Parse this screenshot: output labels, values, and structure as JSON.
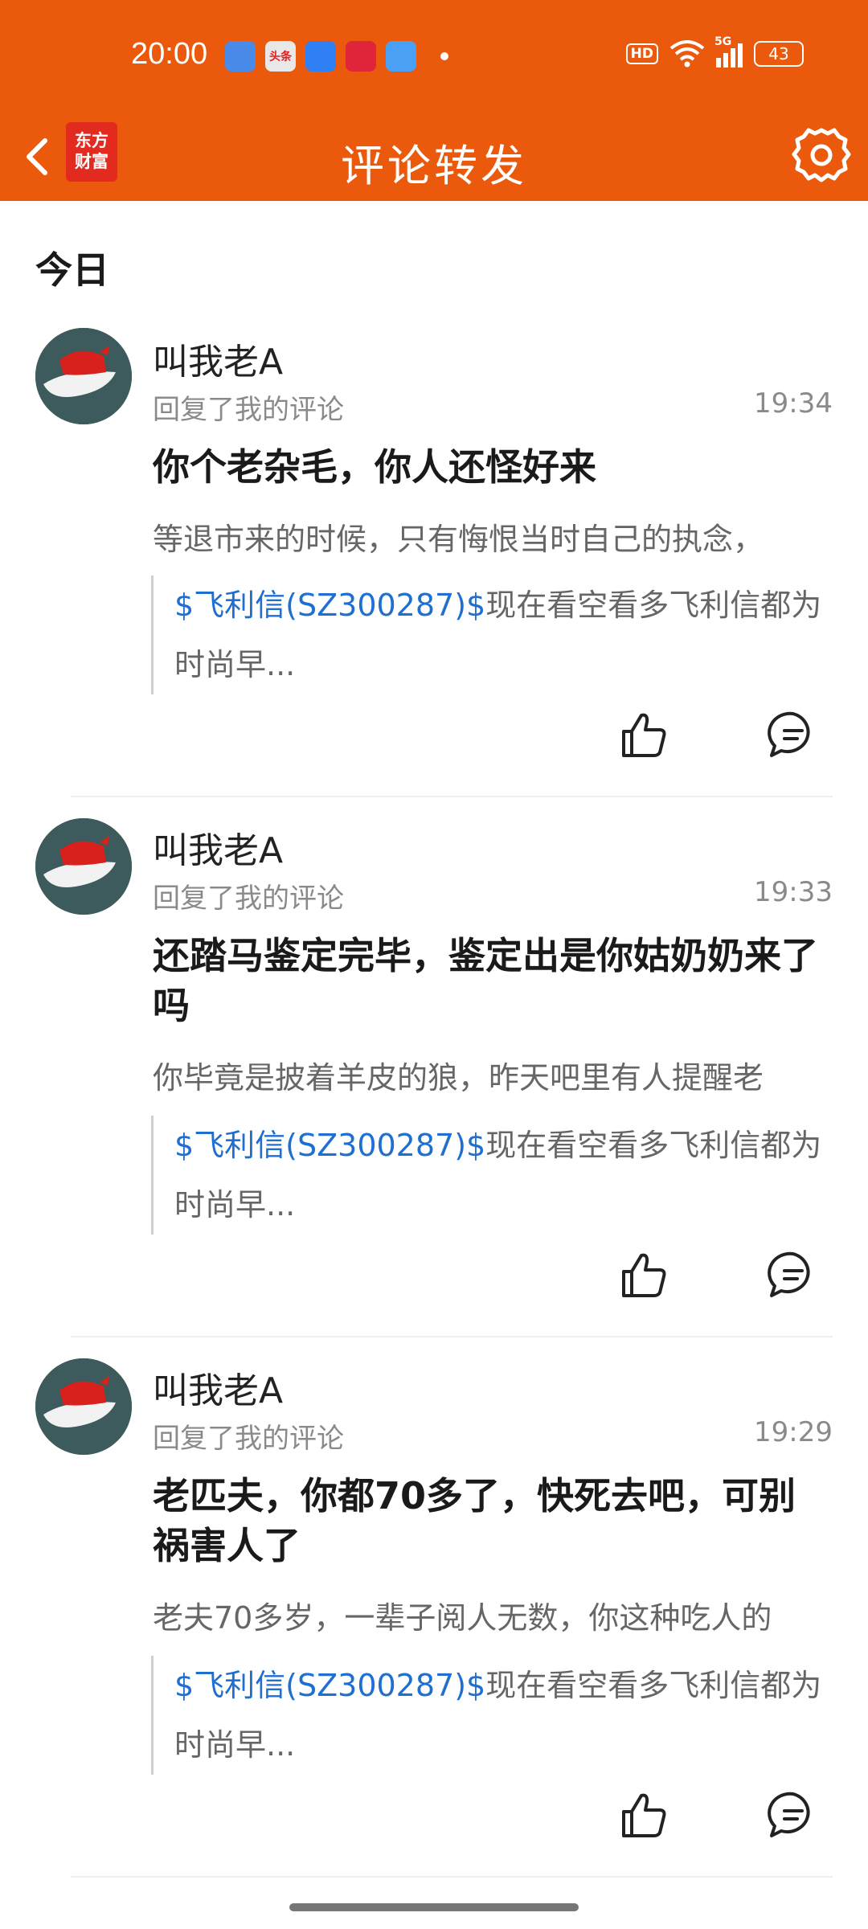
{
  "status": {
    "time": "20:00",
    "network": "5G",
    "hd": "HD",
    "battery": "43",
    "notif_labels": [
      "",
      "头条",
      "",
      "",
      ""
    ]
  },
  "header": {
    "title": "评论转发",
    "logo_line1": "东方",
    "logo_line2": "财富"
  },
  "section": {
    "title": "今日"
  },
  "items": [
    {
      "user": "叫我老A",
      "action": "回复了我的评论",
      "time": "19:34",
      "comment": "你个老杂毛，你人还怪好来",
      "original": "等退市来的时候，只有悔恨当时自己的执念，",
      "quote_stock": "$飞利信(SZ300287)$",
      "quote_text": "现在看空看多飞利信都为时尚早..."
    },
    {
      "user": "叫我老A",
      "action": "回复了我的评论",
      "time": "19:33",
      "comment": "还踏马鉴定完毕，鉴定出是你姑奶奶来了吗",
      "original": "你毕竟是披着羊皮的狼，昨天吧里有人提醒老",
      "quote_stock": "$飞利信(SZ300287)$",
      "quote_text": "现在看空看多飞利信都为时尚早..."
    },
    {
      "user": "叫我老A",
      "action": "回复了我的评论",
      "time": "19:29",
      "comment": "老匹夫，你都70多了，快死去吧，可别祸害人了",
      "original": "老夫70多岁，一辈子阅人无数，你这种吃人的",
      "quote_stock": "$飞利信(SZ300287)$",
      "quote_text": "现在看空看多飞利信都为时尚早..."
    }
  ],
  "colors": {
    "brand": "#EB5A0C",
    "link": "#1f6fd1"
  }
}
